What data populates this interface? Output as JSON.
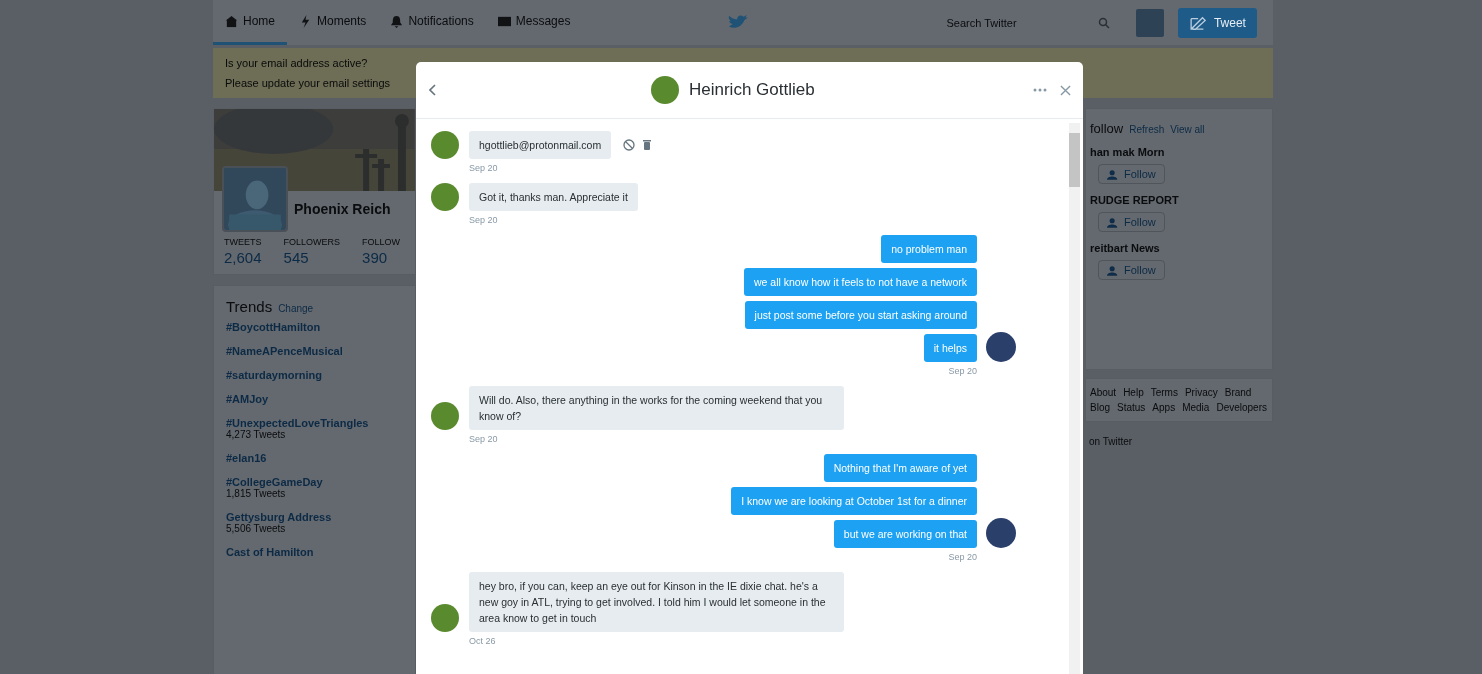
{
  "nav": {
    "tabs": [
      {
        "label": "Home",
        "selected": true
      },
      {
        "label": "Moments",
        "selected": false
      },
      {
        "label": "Notifications",
        "selected": false
      },
      {
        "label": "Messages",
        "selected": false
      }
    ],
    "search": {
      "placeholder": "Search Twitter"
    },
    "tweet_button": "Tweet"
  },
  "banner": {
    "lines": [
      "Is your email address active?",
      "Please update your email settings"
    ]
  },
  "profile": {
    "name": "Phoenix Reich",
    "stats": [
      {
        "label": "TWEETS",
        "value": "2,604"
      },
      {
        "label": "FOLLOWERS",
        "value": "545"
      },
      {
        "label": "FOLLOW",
        "value": "390"
      }
    ]
  },
  "trends": {
    "title": "Trends",
    "change": "Change",
    "items": [
      {
        "name": "#BoycottHamilton"
      },
      {
        "name": "#NameAPenceMusical"
      },
      {
        "name": "#saturdaymorning"
      },
      {
        "name": "#AMJoy"
      },
      {
        "name": "#UnexpectedLoveTriangles",
        "count": "4,273 Tweets"
      },
      {
        "name": "#elan16"
      },
      {
        "name": "#CollegeGameDay",
        "count": "1,815 Tweets"
      },
      {
        "name": "Gettysburg Address",
        "count": "5,506 Tweets"
      },
      {
        "name": "Cast of Hamilton"
      }
    ]
  },
  "who_to_follow": {
    "title": "follow",
    "refresh": "Refresh",
    "view_all": "View all",
    "accounts": [
      {
        "name": "han mak Morn",
        "follow": "Follow"
      },
      {
        "name": "RUDGE REPORT",
        "follow": "Follow"
      },
      {
        "name": "reitbart News",
        "follow": "Follow"
      }
    ]
  },
  "footer": {
    "links": [
      "About",
      "Help",
      "Terms",
      "Privacy",
      "Brand",
      "Blog",
      "Status",
      "Apps",
      "Media",
      "Developers"
    ],
    "note": "on Twitter"
  },
  "conversation": {
    "title": "Heinrich Gottlieb",
    "messages": [
      {
        "kind": "received",
        "bubbles": [
          "hgottlieb@protonmail.com"
        ],
        "time": "Sep 20",
        "actions": true
      },
      {
        "kind": "received",
        "bubbles": [
          "Got it, thanks man. Appreciate it"
        ],
        "time": "Sep 20",
        "actions": false
      },
      {
        "kind": "sent",
        "bubbles": [
          "no problem man",
          "we all know how it feels to not have a network",
          "just post some before you start asking around",
          "it helps"
        ],
        "time": "Sep 20",
        "actions": false
      },
      {
        "kind": "received",
        "bubbles": [
          "Will do. Also, there anything in the works for the coming weekend that you know of?"
        ],
        "time": "Sep 20",
        "actions": false
      },
      {
        "kind": "sent",
        "bubbles": [
          "Nothing that I'm aware of yet",
          "I know we are looking at October 1st for a dinner",
          "but we are working on that"
        ],
        "time": "Sep 20",
        "actions": false
      },
      {
        "kind": "received",
        "bubbles": [
          "hey bro, if you can, keep an eye out for Kinson in the IE dixie chat. he's a new goy in ATL, trying to get involved. I told him I would let someone in the area know to get in touch"
        ],
        "time": "Oct 26",
        "actions": false
      }
    ]
  }
}
